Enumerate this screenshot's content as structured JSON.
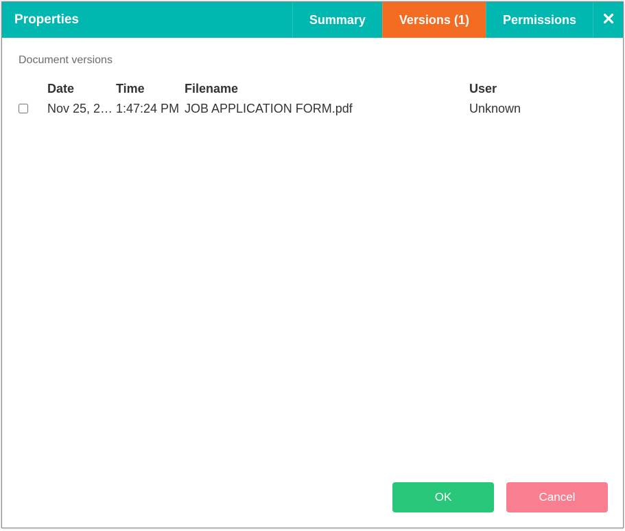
{
  "header": {
    "title": "Properties",
    "tabs": {
      "summary": "Summary",
      "versions": "Versions (1)",
      "permissions": "Permissions"
    }
  },
  "section": {
    "title": "Document versions"
  },
  "table": {
    "headers": {
      "date": "Date",
      "time": "Time",
      "filename": "Filename",
      "user": "User"
    },
    "rows": [
      {
        "date": "Nov 25, 2…",
        "time": "1:47:24 PM",
        "filename": "JOB APPLICATION FORM.pdf",
        "user": "Unknown"
      }
    ]
  },
  "footer": {
    "ok": "OK",
    "cancel": "Cancel"
  }
}
